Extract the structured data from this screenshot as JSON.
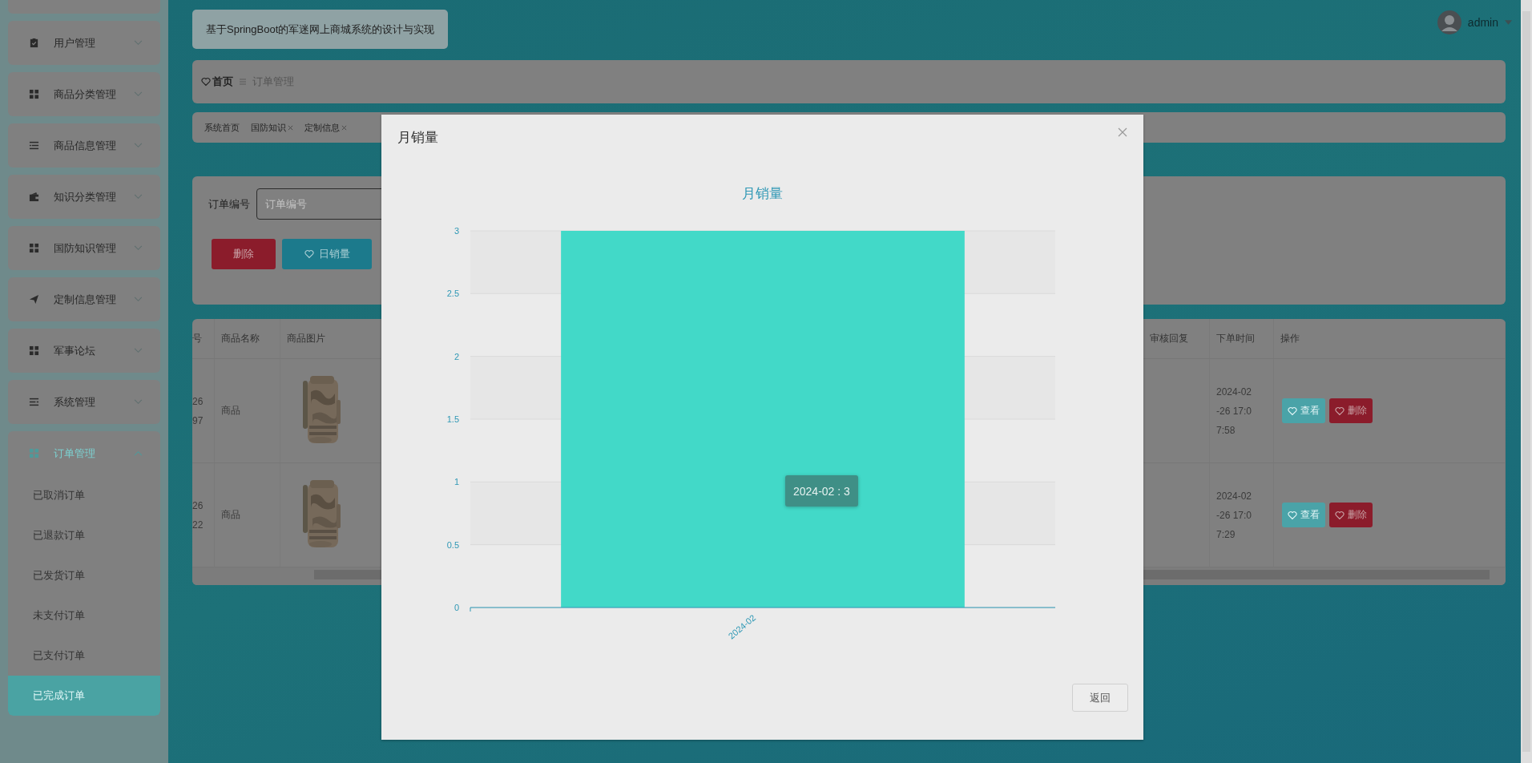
{
  "header": {
    "title": "基于SpringBoot的军迷网上商城系统的设计与实现",
    "user": "admin"
  },
  "sidebar": {
    "items": [
      {
        "label": "用户管理",
        "expanded": false
      },
      {
        "label": "商品分类管理",
        "expanded": false
      },
      {
        "label": "商品信息管理",
        "expanded": false
      },
      {
        "label": "知识分类管理",
        "expanded": false
      },
      {
        "label": "国防知识管理",
        "expanded": false
      },
      {
        "label": "定制信息管理",
        "expanded": false
      },
      {
        "label": "军事论坛",
        "expanded": false
      },
      {
        "label": "系统管理",
        "expanded": false
      },
      {
        "label": "订单管理",
        "expanded": true,
        "children": [
          {
            "label": "已取消订单",
            "selected": false
          },
          {
            "label": "已退款订单",
            "selected": false
          },
          {
            "label": "已发货订单",
            "selected": false
          },
          {
            "label": "未支付订单",
            "selected": false
          },
          {
            "label": "已支付订单",
            "selected": false
          },
          {
            "label": "已完成订单",
            "selected": true
          }
        ]
      }
    ]
  },
  "breadcrumb": [
    {
      "label": "首页",
      "current": false
    },
    {
      "label": "订单管理",
      "current": true
    }
  ],
  "tags": [
    {
      "label": "系统首页",
      "closable": false
    },
    {
      "label": "国防知识",
      "closable": true
    },
    {
      "label": "定制信息",
      "closable": true
    }
  ],
  "search": {
    "label": "订单编号",
    "placeholder": "订单编号"
  },
  "actions": [
    {
      "label": "删除",
      "kind": "danger"
    },
    {
      "label": "日销量",
      "kind": "primary"
    }
  ],
  "table": {
    "columns_left": [
      "号",
      "商品名称",
      "商品图片"
    ],
    "columns_right": [
      "审核回复",
      "下单时间",
      "操作"
    ],
    "rows": [
      {
        "column_1": "2697",
        "name": "商品",
        "picture": {
          "kind": "picture"
        },
        "time": "2024-02-26 17:07:58",
        "actions": [
          {
            "label": "查看",
            "kind": "view"
          },
          {
            "label": "删除",
            "kind": "danger"
          }
        ]
      },
      {
        "column_1": "2622",
        "name": "商品",
        "picture": {
          "kind": "picture"
        },
        "time": "2024-02-26 17:07:29",
        "actions": [
          {
            "label": "查看",
            "kind": "view"
          },
          {
            "label": "删除",
            "kind": "danger"
          }
        ]
      }
    ]
  },
  "modal": {
    "title": "月销量",
    "tooltip": "2024-02 : 3",
    "button": "返回",
    "chart_data": {
      "type": "bar",
      "title": "月销量",
      "categories": [
        "2024-02"
      ],
      "series": [
        {
          "color": "#42d9c8",
          "values": [
            3
          ]
        }
      ],
      "grid": true,
      "ylim": [
        0,
        3
      ],
      "yticks": [
        0,
        0.5,
        1,
        1.5,
        2,
        2.5,
        3
      ]
    }
  }
}
